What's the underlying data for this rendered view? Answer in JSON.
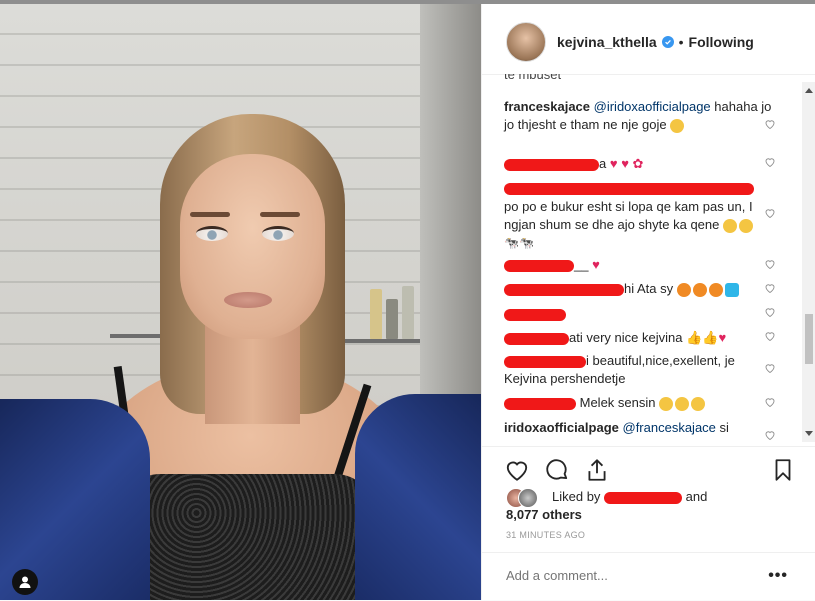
{
  "post": {
    "username": "kejvina_kthella",
    "separator": "•",
    "follow_status": "Following"
  },
  "comments": [
    {
      "user": "",
      "text": "te mbuset"
    },
    {
      "user": "franceskajace",
      "mention": "@iridoxaofficialpage",
      "text": "hahaha jo jo thjesht e tham ne nje goje"
    },
    {
      "user": "",
      "text": "a"
    },
    {
      "user": "",
      "text": ""
    },
    {
      "user": "",
      "text": "po po e bukur esht si lopa qe kam pas un, I ngjan shum se dhe ajo shyte ka qene"
    },
    {
      "user": "",
      "text": "__"
    },
    {
      "user": "",
      "text": "hi Ata sy"
    },
    {
      "user": "",
      "text": ""
    },
    {
      "user": "",
      "text": "ati very nice kejvina"
    },
    {
      "user": "",
      "text": "i beautiful,nice,exellent, je Kejvina pershendetje"
    },
    {
      "user": "",
      "text": "Melek sensin"
    },
    {
      "user": "iridoxaofficialpage",
      "mention": "@franceskajace",
      "text": "si"
    }
  ],
  "likes": {
    "prefix": "Liked by",
    "and": "and",
    "others": "8,077 others"
  },
  "timestamp": "31 MINUTES AGO",
  "comment_box": {
    "placeholder": "Add a comment...",
    "more": "•••"
  },
  "icons": {
    "like": "heart-icon",
    "comment": "comment-icon",
    "share": "share-icon",
    "save": "bookmark-icon",
    "verified": "verified-badge-icon",
    "user_tag": "user-tag-icon"
  },
  "colors": {
    "verified": "#3897f0",
    "redaction": "#f01818",
    "text": "#262626",
    "muted": "#999999"
  }
}
